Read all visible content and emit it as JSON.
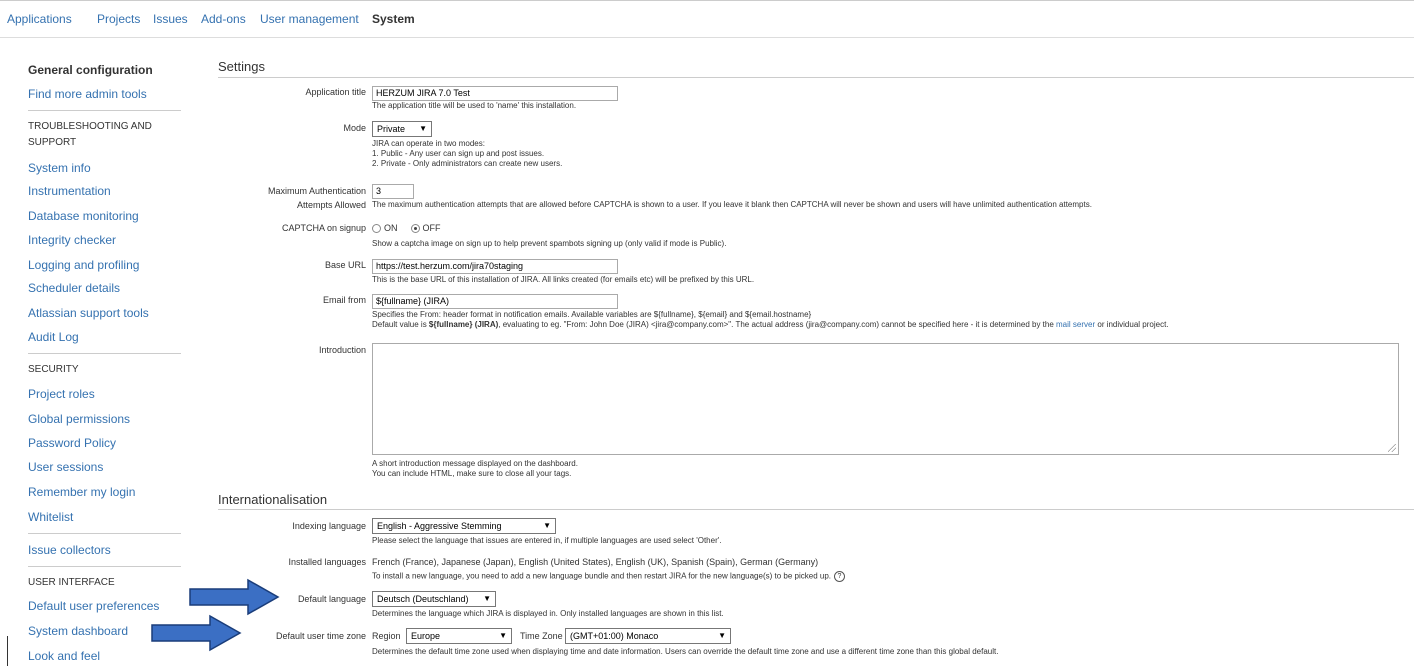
{
  "topnav": {
    "items": [
      {
        "label": "Applications"
      },
      {
        "label": "Projects"
      },
      {
        "label": "Issues"
      },
      {
        "label": "Add-ons"
      },
      {
        "label": "User management"
      },
      {
        "label": "System",
        "active": true
      }
    ]
  },
  "sidebar": {
    "general_configuration": "General configuration",
    "find_more_admin_tools": "Find more admin tools",
    "troubleshooting_heading": "TROUBLESHOOTING AND SUPPORT",
    "troubleshooting_items": [
      "System info",
      "Instrumentation",
      "Database monitoring",
      "Integrity checker",
      "Logging and profiling",
      "Scheduler details",
      "Atlassian support tools",
      "Audit Log"
    ],
    "security_heading": "SECURITY",
    "security_items": [
      "Project roles",
      "Global permissions",
      "Password Policy",
      "User sessions",
      "Remember my login",
      "Whitelist"
    ],
    "issue_collectors": "Issue collectors",
    "ui_heading": "USER INTERFACE",
    "ui_items": [
      "Default user preferences",
      "System dashboard",
      "Look and feel"
    ]
  },
  "settings": {
    "section_title": "Settings",
    "app_title": {
      "label": "Application title",
      "value": "HERZUM JIRA 7.0 Test",
      "desc": "The application title will be used to 'name' this installation."
    },
    "mode": {
      "label": "Mode",
      "value": "Private",
      "desc": [
        "JIRA can operate in two modes:",
        "1. Public - Any user can sign up and post issues.",
        "2. Private - Only administrators can create new users."
      ]
    },
    "max_auth": {
      "label_line1": "Maximum Authentication",
      "label_line2": "Attempts Allowed",
      "value": "3",
      "desc": "The maximum authentication attempts that are allowed before CAPTCHA is shown to a user. If you leave it blank then CAPTCHA will never be shown and users will have unlimited authentication attempts."
    },
    "captcha": {
      "label": "CAPTCHA on signup",
      "on_label": "ON",
      "off_label": "OFF",
      "selected": "OFF",
      "desc": "Show a captcha image on sign up to help prevent spambots signing up (only valid if mode is Public)."
    },
    "base_url": {
      "label": "Base URL",
      "value": "https://test.herzum.com/jira70staging",
      "desc": "This is the base URL of this installation of JIRA. All links created (for emails etc) will be prefixed by this URL."
    },
    "email_from": {
      "label": "Email from",
      "value": "${fullname} (JIRA)",
      "desc1": "Specifies the From: header format in notification emails. Available variables are ${fullname}, ${email} and ${email.hostname}",
      "desc2_pre": "Default value is ",
      "desc2_bold": "${fullname} (JIRA)",
      "desc2_mid": ", evaluating to eg. \"From: John Doe (JIRA) <jira@company.com>\". The actual address (jira@company.com) cannot be specified here - it is determined by the ",
      "desc2_link": "mail server",
      "desc2_post": " or individual project."
    },
    "introduction": {
      "label": "Introduction",
      "value": "",
      "desc": [
        "A short introduction message displayed on the dashboard.",
        "You can include HTML, make sure to close all your tags."
      ]
    }
  },
  "i18n": {
    "section_title": "Internationalisation",
    "indexing_language": {
      "label": "Indexing language",
      "value": "English - Aggressive Stemming",
      "desc": "Please select the language that issues are entered in, if multiple languages are used select 'Other'."
    },
    "installed_languages": {
      "label": "Installed languages",
      "value": "French (France), Japanese (Japan), English (United States), English (UK), Spanish (Spain), German (Germany)",
      "desc": "To install a new language, you need to add a new language bundle and then restart JIRA for the new language(s) to be picked up.",
      "help_glyph": "?"
    },
    "default_language": {
      "label": "Default language",
      "value": "Deutsch (Deutschland)",
      "desc": "Determines the language which JIRA is displayed in. Only installed languages are shown in this list."
    },
    "default_timezone": {
      "label": "Default user time zone",
      "region_label": "Region",
      "region_value": "Europe",
      "tz_label": "Time Zone",
      "tz_value": "(GMT+01:00) Monaco",
      "desc": "Determines the default time zone used when displaying time and date information. Users can override the default time zone and use a different time zone than this global default."
    }
  },
  "dropdown_arrow": "▼",
  "colors": {
    "link": "#3572b0",
    "arrow_fill": "#3b6fc4",
    "arrow_stroke": "#1a3d7a"
  }
}
